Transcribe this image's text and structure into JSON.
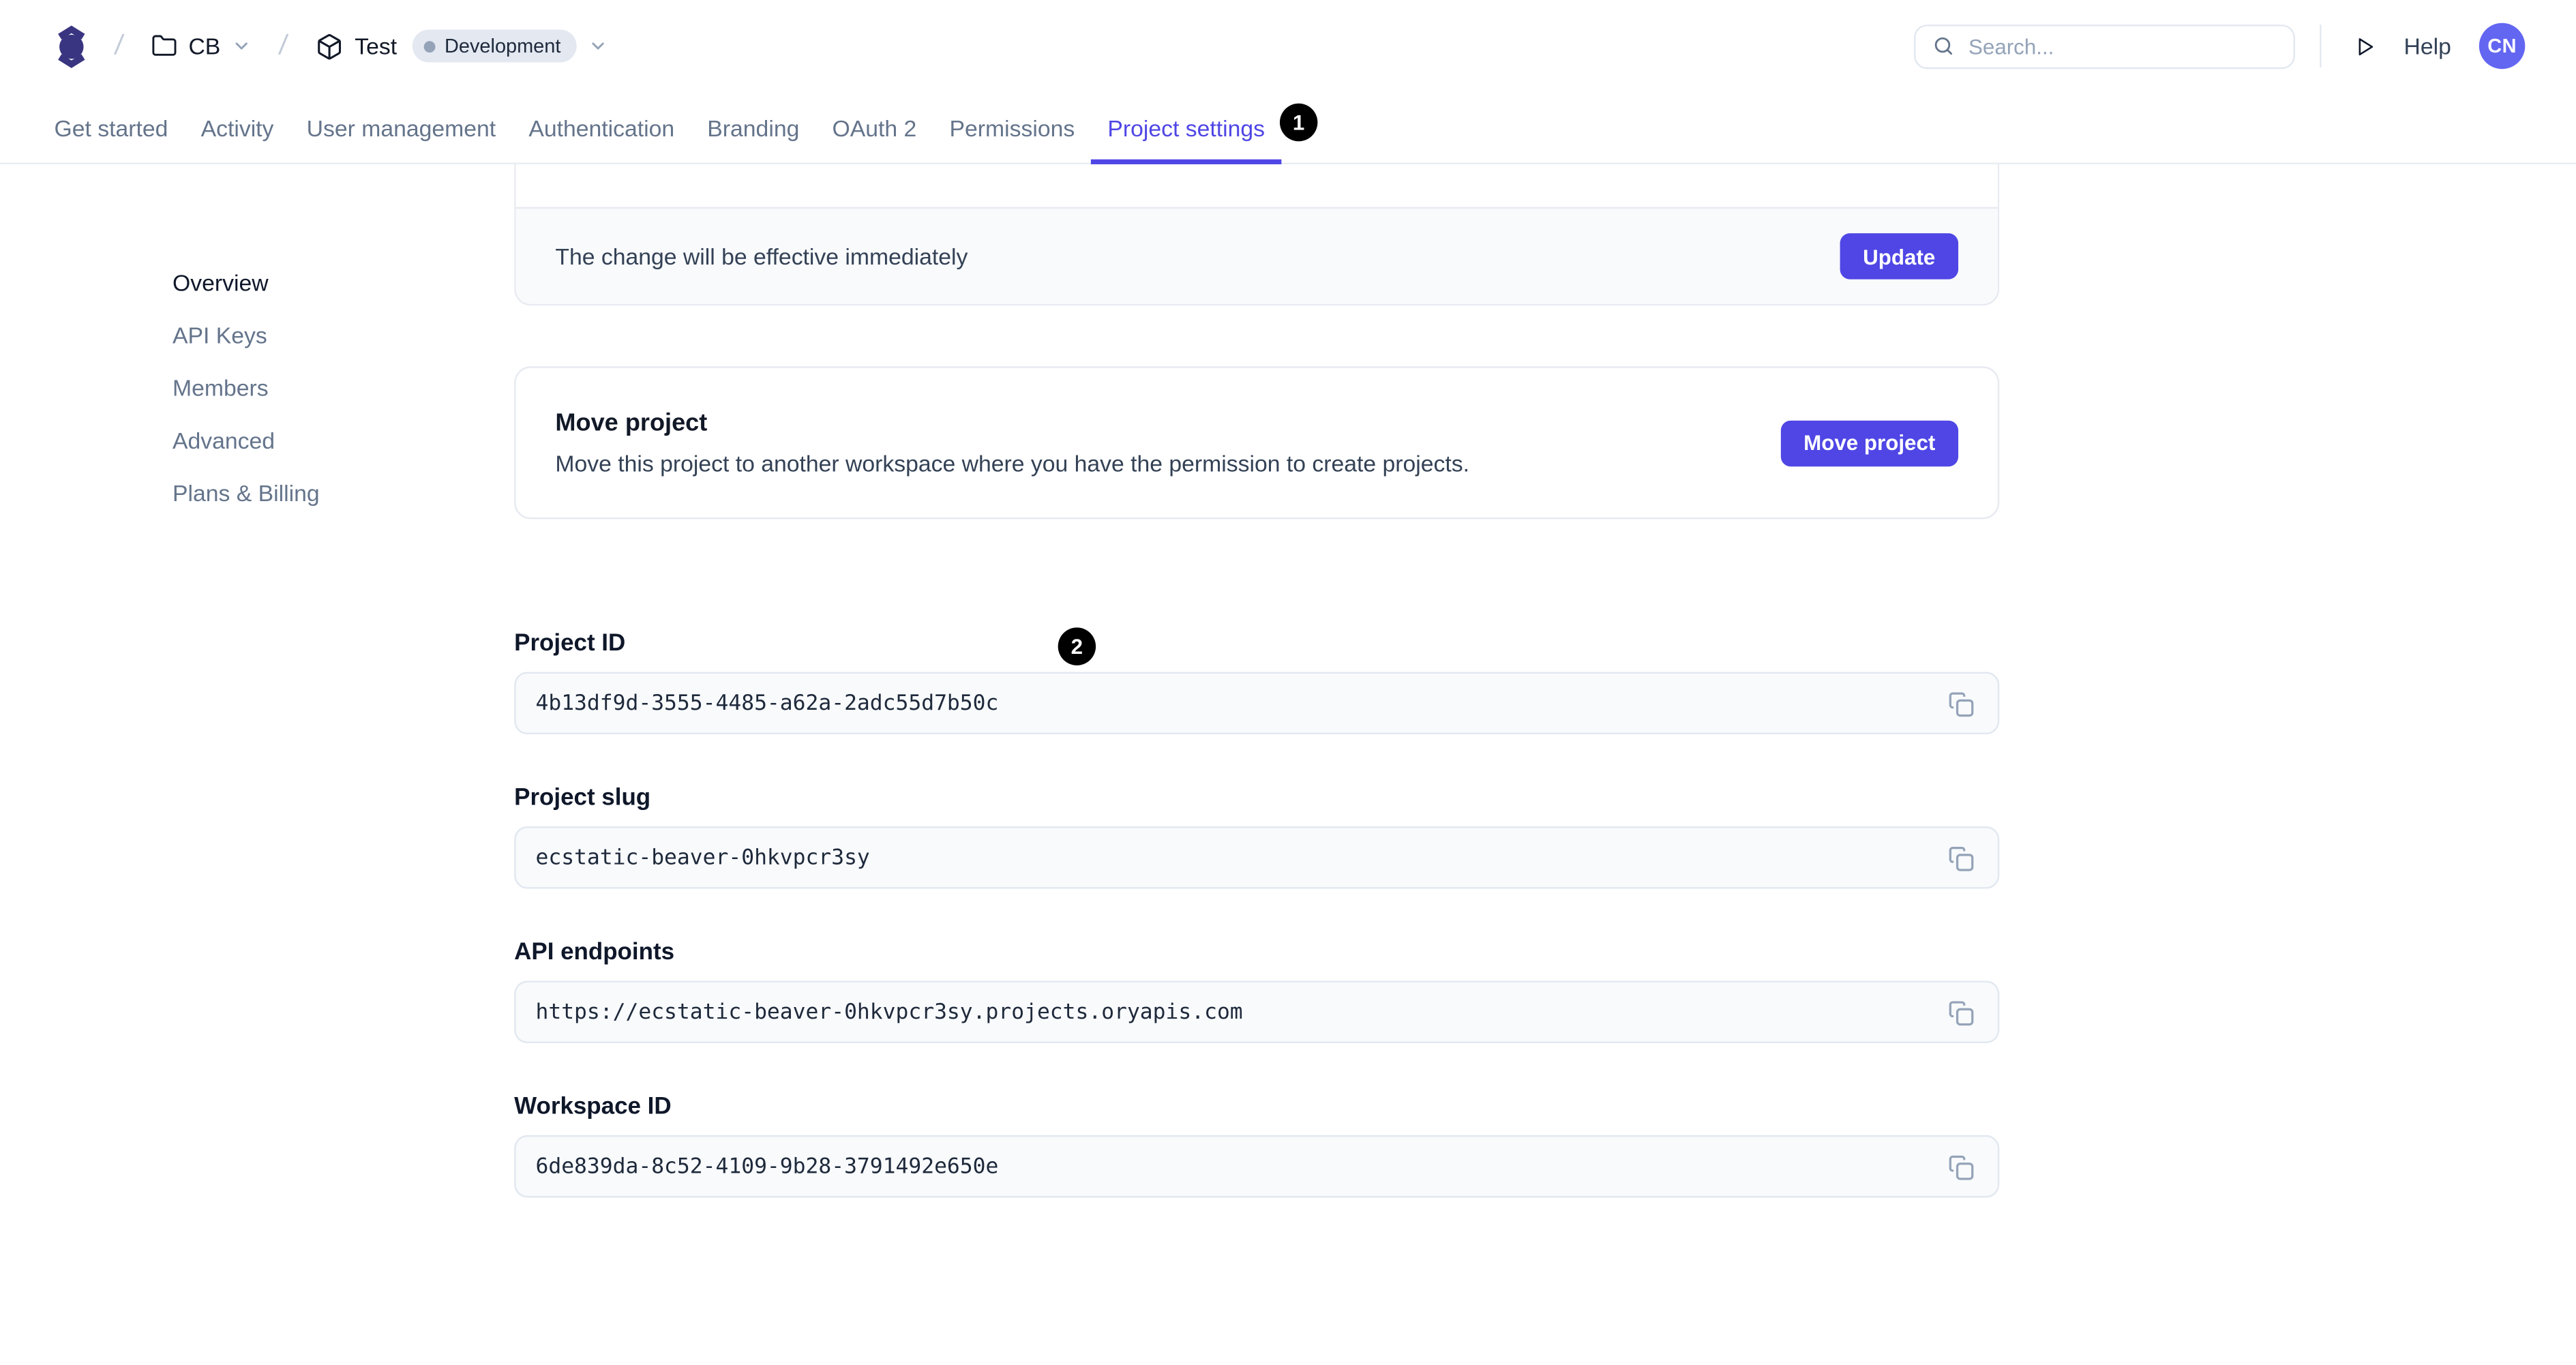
{
  "header": {
    "breadcrumb": {
      "separator": "/",
      "workspace_label": "CB",
      "project_label": "Test",
      "environment_badge": "Development"
    },
    "search": {
      "placeholder": "Search..."
    },
    "help_label": "Help",
    "avatar_initials": "CN"
  },
  "tabs": [
    {
      "label": "Get started",
      "active": false
    },
    {
      "label": "Activity",
      "active": false
    },
    {
      "label": "User management",
      "active": false
    },
    {
      "label": "Authentication",
      "active": false
    },
    {
      "label": "Branding",
      "active": false
    },
    {
      "label": "OAuth 2",
      "active": false
    },
    {
      "label": "Permissions",
      "active": false
    },
    {
      "label": "Project settings",
      "active": true
    }
  ],
  "annotations": [
    {
      "number": "1"
    },
    {
      "number": "2"
    }
  ],
  "sidebar": {
    "items": [
      {
        "label": "Overview",
        "active": true
      },
      {
        "label": "API Keys",
        "active": false
      },
      {
        "label": "Members",
        "active": false
      },
      {
        "label": "Advanced",
        "active": false
      },
      {
        "label": "Plans & Billing",
        "active": false
      }
    ]
  },
  "main": {
    "update_section": {
      "message": "The change will be effective immediately",
      "button_label": "Update"
    },
    "move_section": {
      "title": "Move project",
      "description": "Move this project to another workspace where you have the permission to create projects.",
      "button_label": "Move project"
    },
    "fields": [
      {
        "label": "Project ID",
        "value": "4b13df9d-3555-4485-a62a-2adc55d7b50c"
      },
      {
        "label": "Project slug",
        "value": "ecstatic-beaver-0hkvpcr3sy"
      },
      {
        "label": "API endpoints",
        "value": "https://ecstatic-beaver-0hkvpcr3sy.projects.oryapis.com"
      },
      {
        "label": "Workspace ID",
        "value": "6de839da-8c52-4109-9b28-3791492e650e"
      }
    ]
  },
  "icons": {
    "logo": "ory-console-logo",
    "workspace": "folder-icon",
    "project": "package-icon",
    "breadcrumb_expand": "chevron-down-icon",
    "search": "search-icon",
    "run": "play-icon",
    "copy": "copy-icon"
  },
  "colors": {
    "accent": "#4f46e5",
    "avatar_bg": "#6366f1",
    "logo": "#3a3580",
    "annotation_bg": "#000000",
    "badge_bg": "#e3e8f1",
    "badge_dot": "#94a3b8",
    "card_footer_bg": "#f8fafc",
    "input_bg": "#f8fafc",
    "border": "#e7eaf0",
    "tab_inactive": "#64748b",
    "text_dark": "#0f172a"
  }
}
